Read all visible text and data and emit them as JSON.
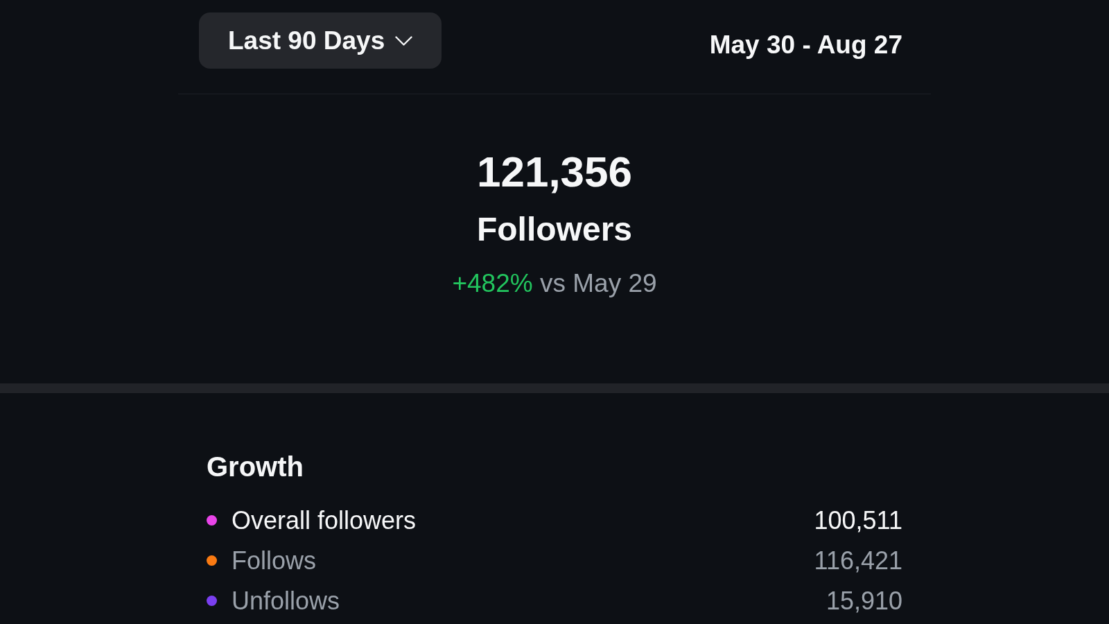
{
  "header": {
    "range_button": {
      "label": "Last 90 Days"
    },
    "date_range": "May 30 - Aug 27"
  },
  "summary": {
    "total": "121,356",
    "label": "Followers",
    "change": "+482%",
    "comparison": "vs May 29"
  },
  "growth": {
    "title": "Growth",
    "rows": [
      {
        "kind": "total",
        "label": "Overall followers",
        "value": "100,511",
        "color": "#e844e8"
      },
      {
        "kind": "detail",
        "label": "Follows",
        "value": "116,421",
        "color": "#f97a12"
      },
      {
        "kind": "detail",
        "label": "Unfollows",
        "value": "15,910",
        "color": "#7a3ff0"
      }
    ]
  }
}
